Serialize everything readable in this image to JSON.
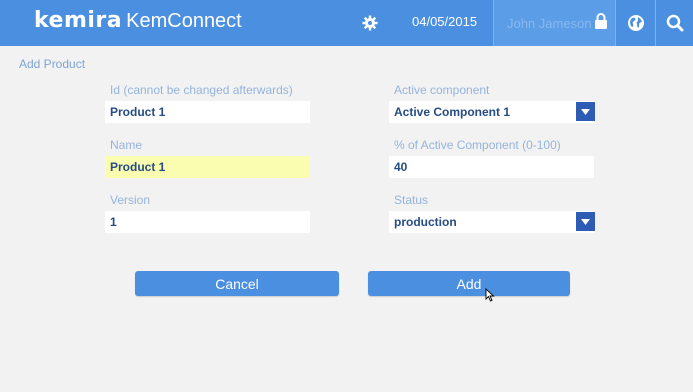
{
  "header": {
    "brand": "Kemira",
    "app_name": "KemConnect",
    "date": "04/05/2015",
    "user": "John Jameson"
  },
  "page": {
    "title": "Add Product"
  },
  "form": {
    "id": {
      "label": "Id (cannot be changed afterwards)",
      "value": "Product 1"
    },
    "name": {
      "label": "Name",
      "value": "Product 1"
    },
    "version": {
      "label": "Version",
      "value": "1"
    },
    "active_component": {
      "label": "Active component",
      "value": "Active Component 1"
    },
    "percent": {
      "label": "% of Active Component (0-100)",
      "value": "40"
    },
    "status": {
      "label": "Status",
      "value": "production"
    }
  },
  "buttons": {
    "cancel": "Cancel",
    "add": "Add"
  },
  "colors": {
    "header": "#4a8fe0",
    "button": "#4a8fe0",
    "label": "#95b4dc",
    "value": "#264c84",
    "highlight": "#fafcb0",
    "select_arrow": "#2e5bb3"
  },
  "icons": {
    "settings": "gear-icon",
    "lock": "lock-icon",
    "language": "globe-icon",
    "search": "search-icon",
    "dropdown": "chevron-down-icon",
    "pointer": "mouse-pointer-icon"
  }
}
